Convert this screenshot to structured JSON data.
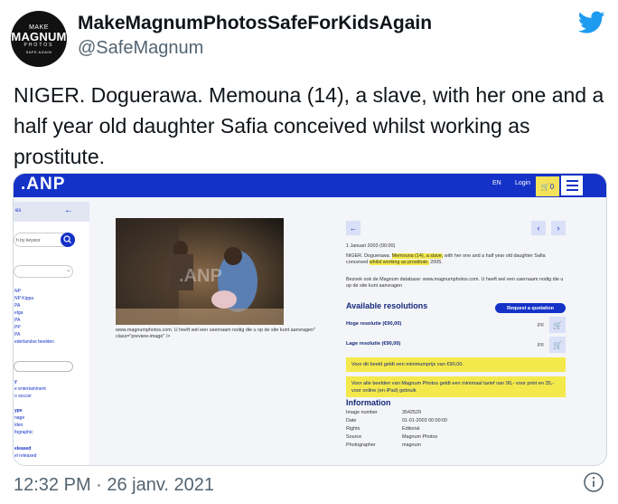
{
  "tweet": {
    "avatar": {
      "line1": "MAKE",
      "line2": "MAGNUM",
      "line3": "PHOTOS",
      "line4": "SAFE AGAIN"
    },
    "display_name": "MakeMagnumPhotosSafeForKidsAgain",
    "handle": "@SafeMagnum",
    "text": "NIGER. Doguerawa. Memouna (14), a slave, with her one and a half year old daughter Safia conceived whilst working as prostitute.",
    "timestamp": "12:32 PM · 26 janv. 2021",
    "brand_color": "#1d9bf0"
  },
  "screenshot": {
    "header": {
      "logo": ".ANP",
      "lang": "EN",
      "login": "Login",
      "cart": "0"
    },
    "sidebar": {
      "top_label": "es",
      "search_placeholder": "h by keywor",
      "items": [
        "NP",
        "NP Kippa",
        "PA",
        "elga",
        "PA",
        "PP",
        "PA",
        "ederlandse beelden"
      ],
      "section1_title": "y",
      "section1_items": [
        "e entertainment",
        "o soccer"
      ],
      "section2_title": "ype",
      "section2_items": [
        "nage",
        "ideo",
        "fographic"
      ],
      "section3_title": "eleased",
      "section3_items": [
        "el released"
      ]
    },
    "image_caption": "www.magnumphotos.com. U heeft wel een usernaam nodig die u op de site kunt aanvragen\" class=\"preview-image\" />",
    "detail": {
      "date": "1 Januari 2003 (00:00)",
      "desc_pre": "NIGER. Doguerawa. ",
      "desc_hl1": "Memouna (14), a slave,",
      "desc_mid": " with her one and a half year old daughter Safia conceived ",
      "desc_hl2": "whilst working as prostitute.",
      "desc_post": " 2005.",
      "visit_text": "Bezoek ook de Magnum database: www.magnumphotos.com. U heeft wel een usernaam nodig die u op de site kunt aanvragen",
      "available_title": "Available resolutions",
      "quote_button": "Request a quotation",
      "resolutions": [
        {
          "label": "Hoge resolutie (€90,00)",
          "format": "jpg"
        },
        {
          "label": "Lage resolutie (€90,00)",
          "format": "jpg"
        }
      ],
      "notice1": "Voor dit beeld geldt een minimumprijs van €90,00.",
      "notice2": "Voor alle beelden van Magnum Photos geldt een minimaal tarief van 90,- voor print en 35,- voor online (en iPad) gebruik",
      "info_title": "Information",
      "info": [
        {
          "key": "Image number",
          "value": "3542529"
        },
        {
          "key": "Date",
          "value": "01-01-2003 00:00:00"
        },
        {
          "key": "Rights",
          "value": "Editorial"
        },
        {
          "key": "Source",
          "value": "Magnum Photos"
        },
        {
          "key": "Photographer",
          "value": "magnum"
        }
      ]
    }
  }
}
